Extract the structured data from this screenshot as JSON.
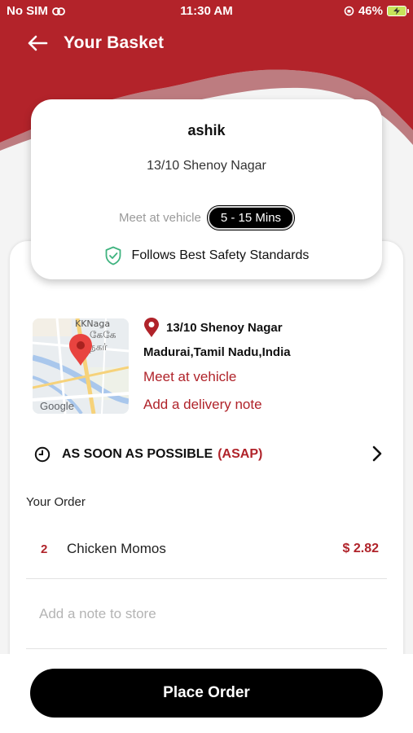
{
  "status_bar": {
    "carrier": "No SIM",
    "time": "11:30 AM",
    "battery": "46%"
  },
  "header": {
    "title": "Your Basket"
  },
  "card": {
    "name": "ashik",
    "address": "13/10 Shenoy Nagar",
    "meet_label": "Meet at vehicle",
    "eta": "5 - 15 Mins",
    "safety": "Follows Best Safety Standards"
  },
  "delivery": {
    "address_line1": "13/10 Shenoy Nagar",
    "address_line2": "Madurai,Tamil Nadu,India",
    "meet_option": "Meet at vehicle",
    "note_link": "Add a delivery note",
    "map_watermark": "Google",
    "map_text_top": "KKNaga",
    "map_text_mid": "கேகே",
    "map_text_bot": "நகர்"
  },
  "schedule": {
    "label": "AS SOON AS POSSIBLE",
    "tag": "(ASAP)"
  },
  "order": {
    "section_label": "Your Order",
    "items": [
      {
        "qty": "2",
        "name": "Chicken Momos",
        "price": "$ 2.82"
      }
    ],
    "note_placeholder": "Add a note to store"
  },
  "actions": {
    "place_order": "Place Order"
  },
  "colors": {
    "brand_red": "#b0232a",
    "header_red": "#b3232a",
    "button_black": "#000000"
  }
}
